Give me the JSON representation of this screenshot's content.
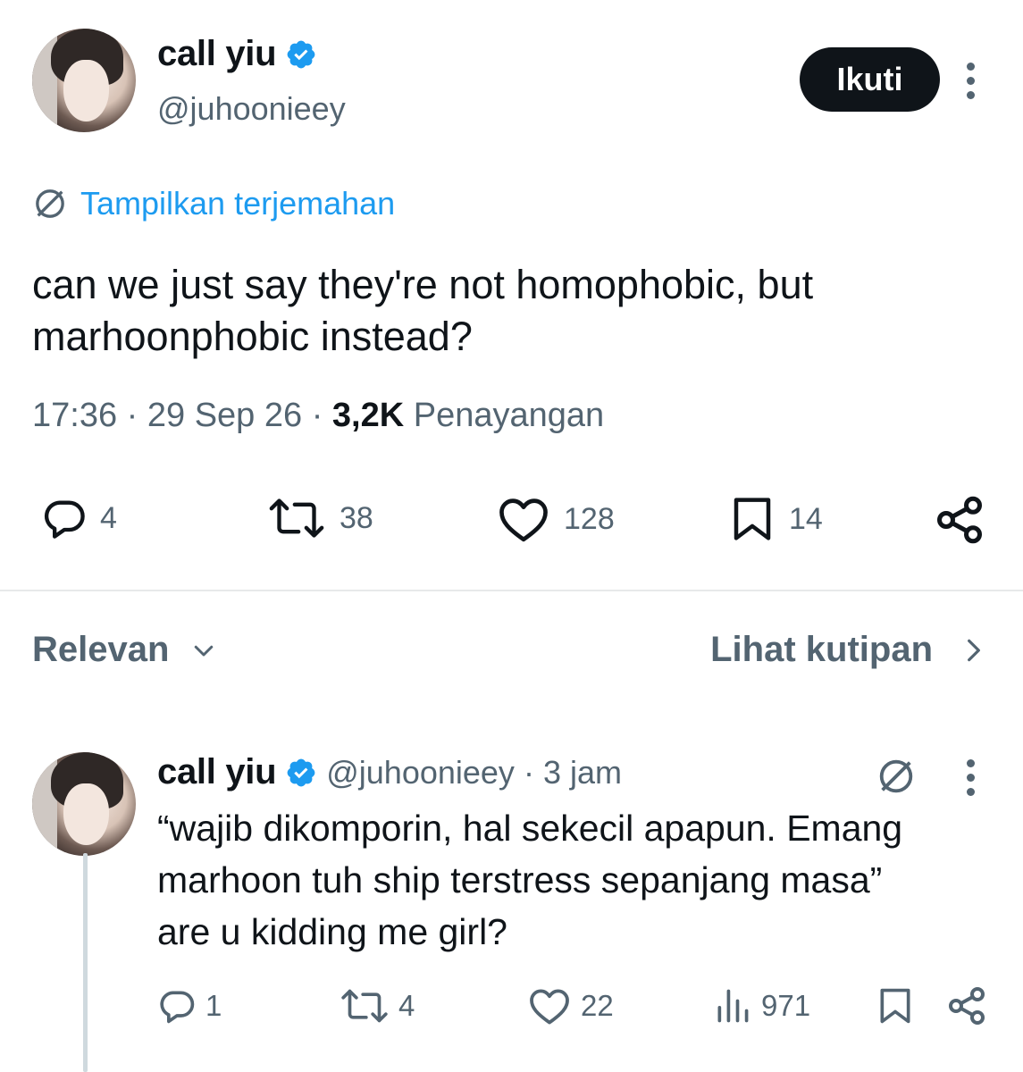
{
  "tweet": {
    "author": {
      "name": "call yiu",
      "handle": "@juhoonieey",
      "verified": true
    },
    "follow_label": "Ikuti",
    "translate_label": "Tampilkan terjemahan",
    "text_line1": "can we just say they're not homophobic, but",
    "text_line2": "marhoonphobic instead?",
    "time": "17:36",
    "date": "29 Sep 26",
    "views_count": "3,2K",
    "views_label": "Penayangan",
    "separator": "·",
    "stats": {
      "replies": "4",
      "reposts": "38",
      "likes": "128",
      "bookmarks": "14"
    }
  },
  "sort_bar": {
    "left_label": "Relevan",
    "right_label": "Lihat kutipan"
  },
  "reply": {
    "author": {
      "name": "call yiu",
      "handle": "@juhoonieey",
      "verified": true
    },
    "time_ago": "3 jam",
    "separator": "·",
    "text_line1": "“wajib dikomporin, hal sekecil apapun. Emang",
    "text_line2": "marhoon tuh ship terstress sepanjang masa”",
    "text_line3": "are u kidding me girl?",
    "stats": {
      "replies": "1",
      "reposts": "4",
      "likes": "22",
      "views": "971"
    }
  },
  "colors": {
    "text": "#0f1419",
    "secondary": "#536471",
    "accent": "#1d9bf0",
    "verified": "#1d9bf0",
    "divider": "#e7e9ea"
  },
  "icons": [
    "verified-badge-icon",
    "more-options-icon",
    "translate-icon",
    "reply-icon",
    "repost-icon",
    "like-icon",
    "bookmark-icon",
    "share-icon",
    "chevron-down-icon",
    "chevron-right-icon",
    "views-icon"
  ]
}
